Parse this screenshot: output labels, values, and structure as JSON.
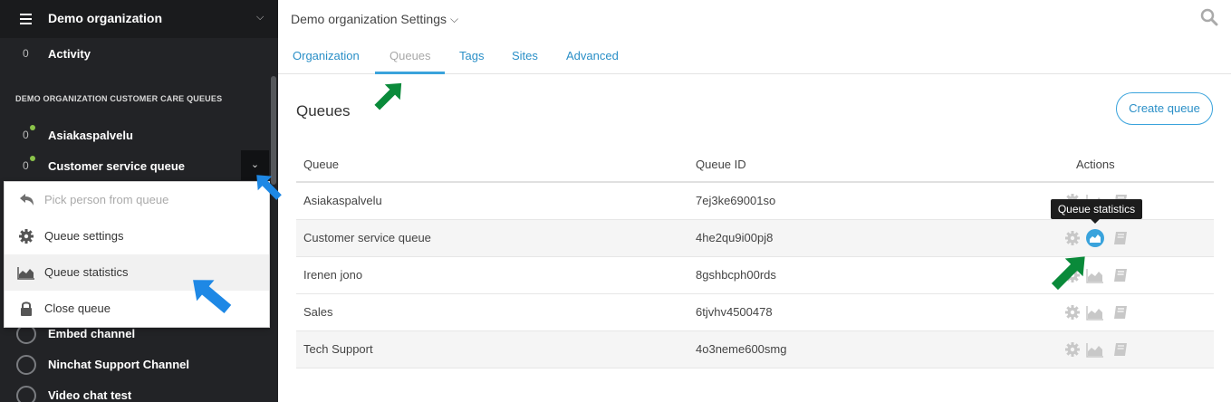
{
  "sidebar": {
    "org_name": "Demo organization",
    "activity": {
      "count": "0",
      "label": "Activity"
    },
    "section_title": "DEMO ORGANIZATION CUSTOMER CARE QUEUES",
    "queues": [
      {
        "count": "0",
        "label": "Asiakaspalvelu"
      },
      {
        "count": "0",
        "label": "Customer service queue"
      }
    ],
    "other_items": [
      {
        "label": "Embed channel"
      },
      {
        "label": "Ninchat Support Channel"
      },
      {
        "label": "Video chat test"
      }
    ]
  },
  "queue_menu": {
    "items": [
      {
        "label": "Pick person from queue",
        "icon": "undo-icon",
        "disabled": true
      },
      {
        "label": "Queue settings",
        "icon": "gear-icon"
      },
      {
        "label": "Queue statistics",
        "icon": "area-chart-icon"
      },
      {
        "label": "Close queue",
        "icon": "lock-icon"
      }
    ]
  },
  "header": {
    "title": "Demo organization Settings"
  },
  "tabs": [
    {
      "label": "Organization"
    },
    {
      "label": "Queues",
      "active": true
    },
    {
      "label": "Tags"
    },
    {
      "label": "Sites"
    },
    {
      "label": "Advanced"
    }
  ],
  "main": {
    "section_title": "Queues",
    "create_button": "Create queue",
    "columns": {
      "queue": "Queue",
      "queue_id": "Queue ID",
      "actions": "Actions"
    },
    "rows": [
      {
        "name": "Asiakaspalvelu",
        "id": "7ej3ke69001so"
      },
      {
        "name": "Customer service queue",
        "id": "4he2qu9i00pj8"
      },
      {
        "name": "Irenen jono",
        "id": "8gshbcph00rds"
      },
      {
        "name": "Sales",
        "id": "6tjvhv4500478"
      },
      {
        "name": "Tech Support",
        "id": "4o3neme600smg"
      }
    ],
    "tooltip": "Queue statistics"
  },
  "colors": {
    "accent": "#3aa3dc",
    "sidebar_bg": "#222326",
    "online": "#8bc34a",
    "annotation_green": "#0a8a3a",
    "annotation_blue": "#1e88e5"
  }
}
